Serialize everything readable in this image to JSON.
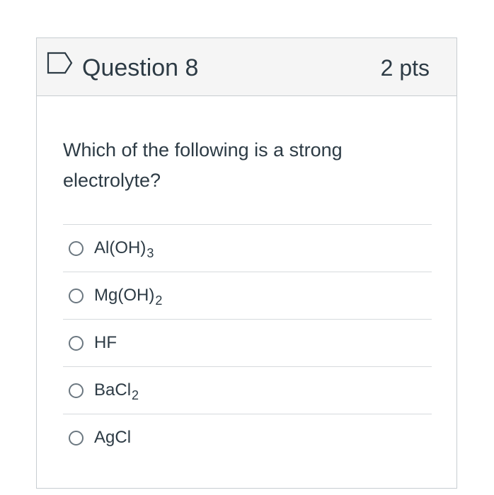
{
  "question": {
    "flag_icon": "bookmark-flag-icon",
    "title": "Question 8",
    "points": "2 pts",
    "text": "Which of the following is a strong electrolyte?"
  },
  "answers": [
    {
      "base": "Al(OH)",
      "sub": "3"
    },
    {
      "base": "Mg(OH)",
      "sub": "2"
    },
    {
      "base": "HF",
      "sub": ""
    },
    {
      "base": "BaCl",
      "sub": "2"
    },
    {
      "base": "AgCl",
      "sub": ""
    }
  ],
  "colors": {
    "text": "#2d3b45",
    "header_bg": "#f5f5f5",
    "border": "#c7cdd1",
    "flag": "#2d3b45"
  }
}
